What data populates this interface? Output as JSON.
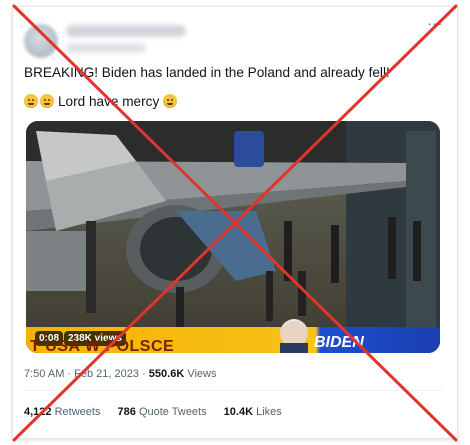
{
  "tweet": {
    "more_label": "···",
    "line1": "BREAKING! Biden has landed in the Poland and already fell!",
    "line2": "Lord have mercy",
    "emojis": [
      "worried-face",
      "rolling-on-floor-laughing",
      "winking-face-with-tongue"
    ]
  },
  "video": {
    "duration": "0:08",
    "views": "238K views",
    "banner_text": "T USA W POLSCE",
    "banner_name": "BIDEN"
  },
  "meta": {
    "time": "7:50 AM",
    "date": "Feb 21, 2023",
    "separator": "·",
    "views_count": "550.6K",
    "views_label": "Views"
  },
  "stats": {
    "retweets_count": "4,122",
    "retweets_label": "Retweets",
    "quotes_count": "786",
    "quotes_label": "Quote Tweets",
    "likes_count": "10.4K",
    "likes_label": "Likes"
  },
  "overlay": {
    "x_color": "#e0352b"
  }
}
